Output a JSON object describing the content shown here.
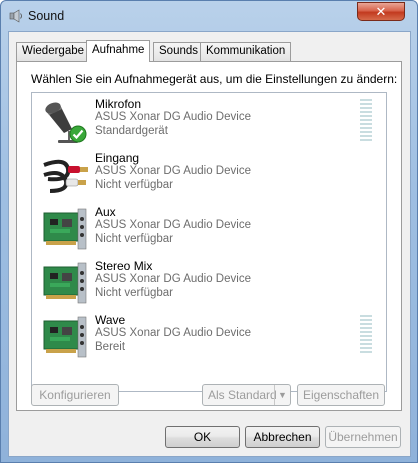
{
  "window": {
    "title": "Sound",
    "close_label": "✕"
  },
  "tabs": [
    {
      "label": "Wiedergabe"
    },
    {
      "label": "Aufnahme"
    },
    {
      "label": "Sounds"
    },
    {
      "label": "Kommunikation"
    }
  ],
  "instruction": "Wählen Sie ein Aufnahmegerät aus, um die Einstellungen zu ändern:",
  "devices": [
    {
      "name": "Mikrofon",
      "device": "ASUS Xonar DG Audio Device",
      "status": "Standardgerät",
      "icon": "microphone-icon",
      "default_badge": true
    },
    {
      "name": "Eingang",
      "device": "ASUS Xonar DG Audio Device",
      "status": "Nicht verfügbar",
      "icon": "rca-cable-icon"
    },
    {
      "name": "Aux",
      "device": "ASUS Xonar DG Audio Device",
      "status": "Nicht verfügbar",
      "icon": "sound-card-icon"
    },
    {
      "name": "Stereo Mix",
      "device": "ASUS Xonar DG Audio Device",
      "status": "Nicht verfügbar",
      "icon": "sound-card-icon"
    },
    {
      "name": "Wave",
      "device": "ASUS Xonar DG Audio Device",
      "status": "Bereit",
      "icon": "sound-card-icon"
    }
  ],
  "buttons": {
    "configure": "Konfigurieren",
    "set_default": "Als Standard",
    "properties": "Eigenschaften",
    "ok": "OK",
    "cancel": "Abbrechen",
    "apply": "Übernehmen"
  },
  "colors": {
    "accent": "#2f7de1",
    "default_check": "#3aa83a"
  }
}
